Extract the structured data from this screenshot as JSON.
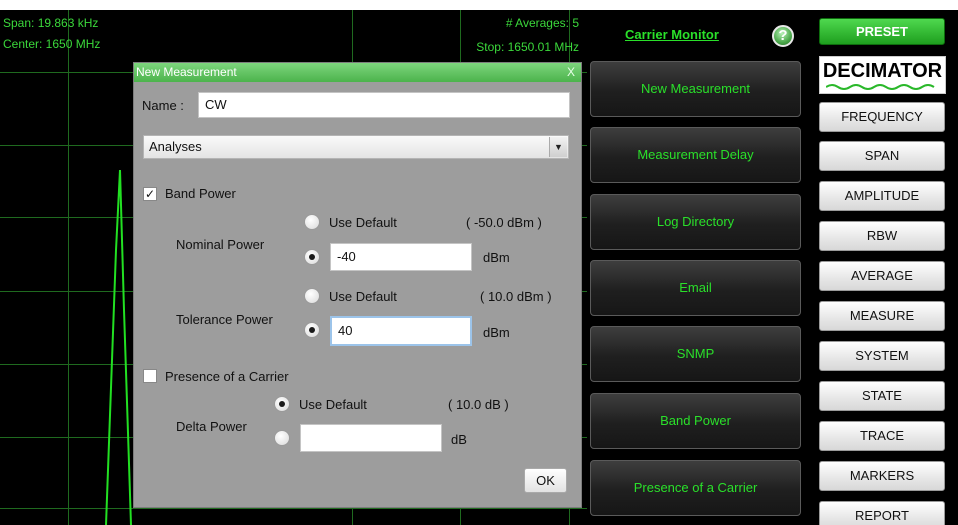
{
  "plot": {
    "span": "Span: 19.863 kHz",
    "center": "Center: 1650 MHz",
    "averages": "# Averages: 5",
    "stop": "Stop: 1650.01 MHz"
  },
  "dialog": {
    "title": "New Measurement",
    "close": "X",
    "name_label": "Name :",
    "name_value": "CW",
    "combo_value": "Analyses",
    "band_power": {
      "label": "Band Power",
      "checked": true,
      "nominal_label": "Nominal Power",
      "nominal_default_label": "Use Default",
      "nominal_default_value": "( -50.0 dBm )",
      "nominal_value": "-40",
      "nominal_unit": "dBm",
      "tolerance_label": "Tolerance Power",
      "tolerance_default_label": "Use Default",
      "tolerance_default_value": "( 10.0 dBm )",
      "tolerance_value": "40",
      "tolerance_unit": "dBm"
    },
    "presence": {
      "label": "Presence of a Carrier",
      "checked": false,
      "delta_label": "Delta Power",
      "delta_default_label": "Use Default",
      "delta_default_value": "( 10.0 dB )",
      "delta_value": "",
      "delta_unit": "dB"
    },
    "ok": "OK"
  },
  "middle": {
    "title": "Carrier Monitor",
    "help": "?",
    "buttons": [
      "New Measurement",
      "Measurement Delay",
      "Log Directory",
      "Email",
      "SNMP",
      "Band Power",
      "Presence of a Carrier"
    ]
  },
  "right": {
    "preset": "PRESET",
    "logo": "DECIMATOR",
    "buttons": [
      "FREQUENCY",
      "SPAN",
      "AMPLITUDE",
      "RBW",
      "AVERAGE",
      "MEASURE",
      "SYSTEM",
      "STATE",
      "TRACE",
      "MARKERS",
      "REPORT"
    ]
  },
  "colors": {
    "accent_green": "#2ae02a",
    "plot_background": "#000000",
    "dialog_background": "#9d9d9d",
    "title_green": "#5cc05c"
  }
}
